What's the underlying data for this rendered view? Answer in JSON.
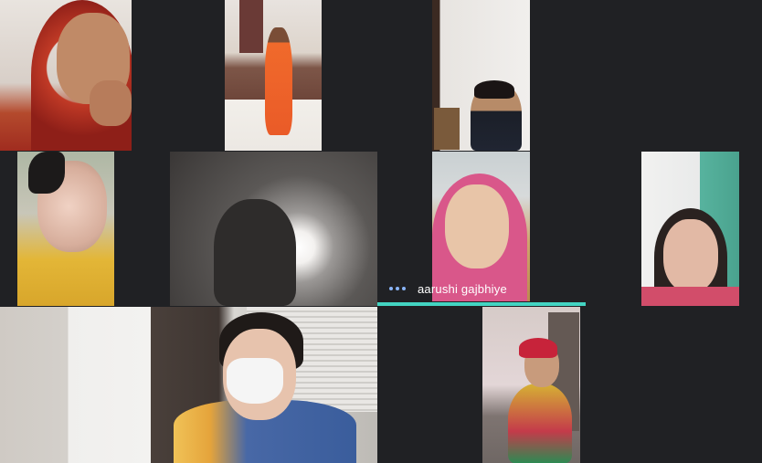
{
  "meeting": {
    "active_speaker_name": "aarushi gajbhiye",
    "more_options_icon": "more-horizontal-icon",
    "speaking_indicator_color": "#43d4c2"
  },
  "participants": [
    {
      "tile": "participant-tile-1",
      "depicts": "child in red scarf"
    },
    {
      "tile": "participant-tile-2",
      "depicts": "child in orange dress"
    },
    {
      "tile": "participant-tile-3",
      "depicts": "boy in dark jacket"
    },
    {
      "tile": "participant-tile-4",
      "depicts": "girl in yellow outfit"
    },
    {
      "tile": "participant-tile-5",
      "depicts": "backlit participant"
    },
    {
      "tile": "participant-tile-6",
      "depicts": "child in pink scarf"
    },
    {
      "tile": "participant-tile-7",
      "depicts": "woman with green background"
    },
    {
      "tile": "participant-tile-8",
      "depicts": "teacher with face mask"
    },
    {
      "tile": "participant-tile-9",
      "depicts": "child in traditional dress"
    }
  ]
}
